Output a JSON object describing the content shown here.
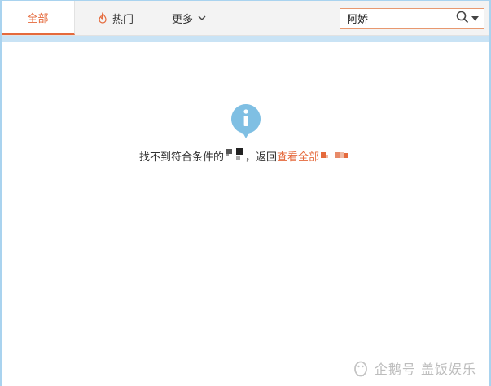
{
  "tabs": {
    "all_label": "全部",
    "hot_label": "热门",
    "more_label": "更多"
  },
  "search": {
    "value": "阿娇",
    "icon": "search-icon"
  },
  "empty_state": {
    "icon": "info-icon",
    "message_before": "找不到符合条件的",
    "message_middle": "，返回",
    "link_label": "查看全部"
  },
  "watermark": {
    "text": "企鹅号 盖饭娱乐",
    "icon": "penguin-icon"
  },
  "colors": {
    "accent": "#e56a3c",
    "info_blue": "#7fbfe3",
    "frame_blue": "#a9d3ef"
  }
}
